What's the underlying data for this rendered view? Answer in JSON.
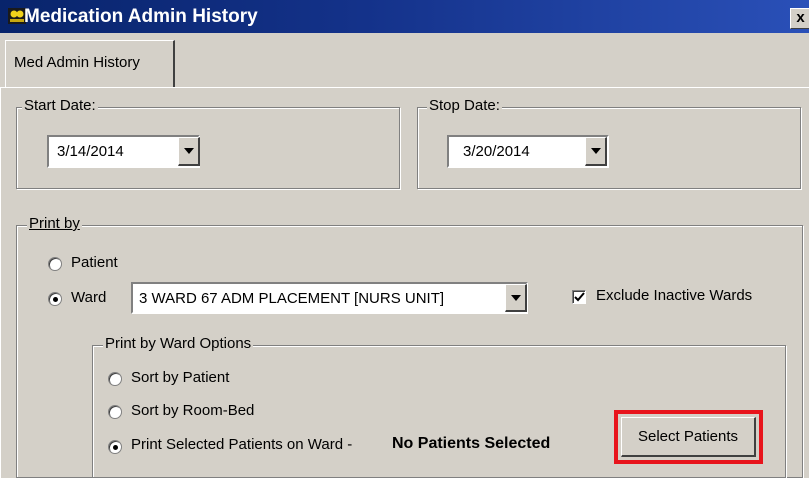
{
  "window": {
    "title": "Medication Admin History",
    "close_label": "x"
  },
  "tabs": [
    {
      "label": "Med Admin History"
    }
  ],
  "start_date": {
    "label": "Start Date:",
    "value": "3/14/2014"
  },
  "stop_date": {
    "label": "Stop Date:",
    "value": "3/20/2014"
  },
  "print_by": {
    "label": "Print by",
    "options": [
      {
        "label": "Patient",
        "selected": false
      },
      {
        "label": "Ward",
        "selected": true
      }
    ],
    "ward_value": "3 WARD 67 ADM PLACEMENT [NURS UNIT]",
    "exclude_inactive": {
      "label": "Exclude Inactive Wards",
      "checked": true
    }
  },
  "ward_options": {
    "label": "Print by Ward Options",
    "options": [
      {
        "label": "Sort by Patient",
        "selected": false
      },
      {
        "label": "Sort by Room-Bed",
        "selected": false
      },
      {
        "label": "Print Selected Patients on Ward -",
        "selected": true
      }
    ],
    "status_text": "No Patients Selected",
    "select_button": "Select Patients"
  },
  "colors": {
    "title_bar": "#08246b",
    "highlight": "#e8141c"
  }
}
